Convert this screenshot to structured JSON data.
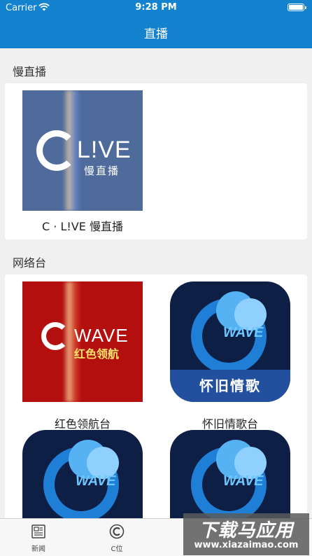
{
  "status_bar": {
    "carrier": "Carrier",
    "time": "9:28 PM"
  },
  "header": {
    "title": "直播"
  },
  "sections": [
    {
      "title": "慢直播",
      "items": [
        {
          "label": "C · L!VE 慢直播",
          "art_text": "L!VE",
          "art_subtext": "慢直播"
        }
      ]
    },
    {
      "title": "网络台",
      "items": [
        {
          "label": "红色领航台",
          "art_text": "WAVE",
          "art_subtext": "红色领航"
        },
        {
          "label": "怀旧情歌台",
          "art_text": "WAVE",
          "art_subtext": "怀旧情歌"
        },
        {
          "label": "",
          "art_text": "WAVE",
          "art_subtext": ""
        },
        {
          "label": "",
          "art_text": "WAVE",
          "art_subtext": ""
        }
      ]
    }
  ],
  "tabbar": {
    "items": [
      {
        "label": "新闻"
      },
      {
        "label": "C位"
      }
    ]
  },
  "watermark": {
    "text": "下载马应用",
    "url": "www.xiazaimao.com"
  }
}
